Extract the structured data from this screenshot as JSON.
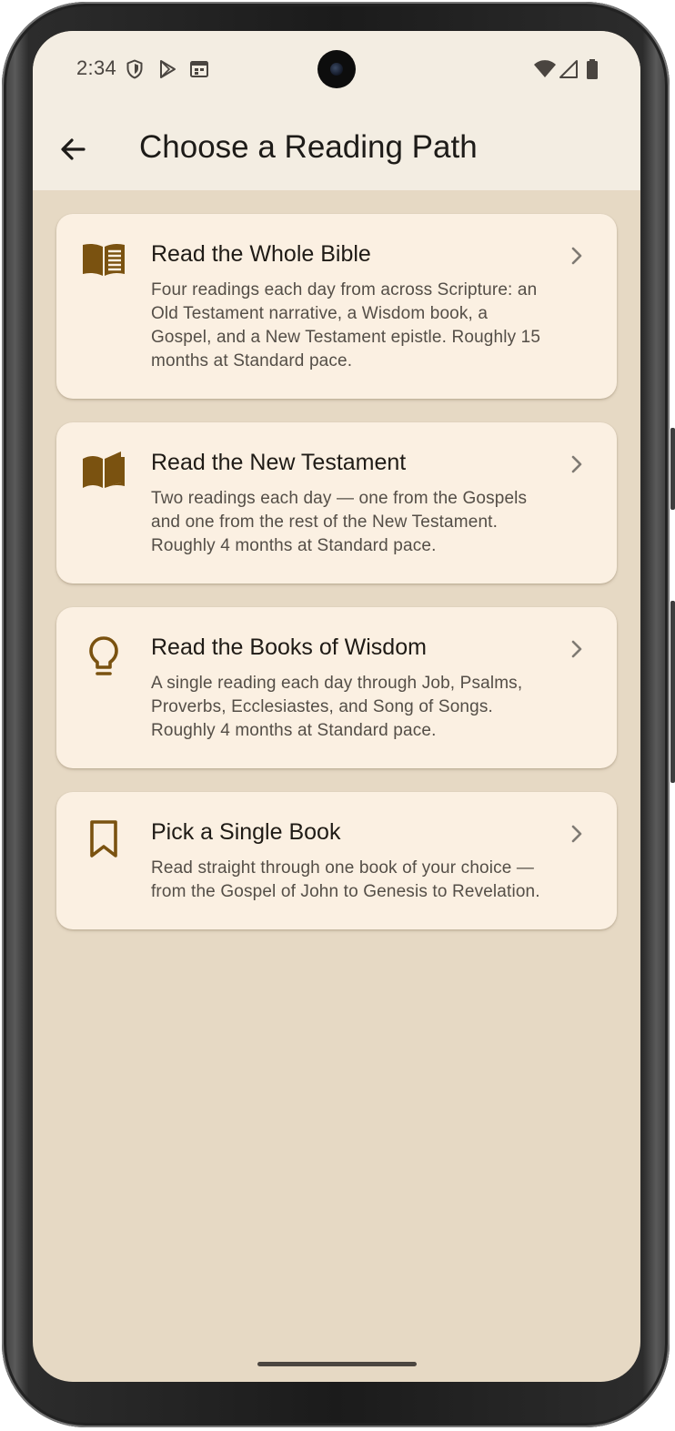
{
  "status_bar": {
    "time": "2:34",
    "left_icons": [
      "shield-icon",
      "play-store-icon",
      "calendar-icon"
    ],
    "right_icons": [
      "wifi-icon",
      "cellular-signal-icon",
      "battery-icon"
    ]
  },
  "app_bar": {
    "back_icon": "arrow-back-icon",
    "title": "Choose a Reading Path"
  },
  "reading_paths": [
    {
      "icon": "open-book-icon",
      "title": "Read the Whole Bible",
      "description": "Four readings each day from across Scripture: an Old Testament narrative, a Wisdom book, a Gospel, and a New Testament epistle. Roughly 15 months at Standard pace."
    },
    {
      "icon": "book-open-pages-icon",
      "title": "Read the New Testament",
      "description": "Two readings each day — one from the Gospels and one from the rest of the New Testament. Roughly 4 months at Standard pace."
    },
    {
      "icon": "lightbulb-icon",
      "title": "Read the Books of Wisdom",
      "description": "A single reading each day through Job, Psalms, Proverbs, Ecclesiastes, and Song of Songs. Roughly 4 months at Standard pace."
    },
    {
      "icon": "bookmark-icon",
      "title": "Pick a Single Book",
      "description": "Read straight through one book of your choice — from the Gospel of John to Genesis to Revelation."
    }
  ],
  "colors": {
    "accent": "#7a5210",
    "screen_background": "#e6d9c4",
    "app_bar_background": "#f3ede2",
    "card_background": "#fbf0e2",
    "title_text": "#1f1b16",
    "body_text": "#544e47"
  }
}
